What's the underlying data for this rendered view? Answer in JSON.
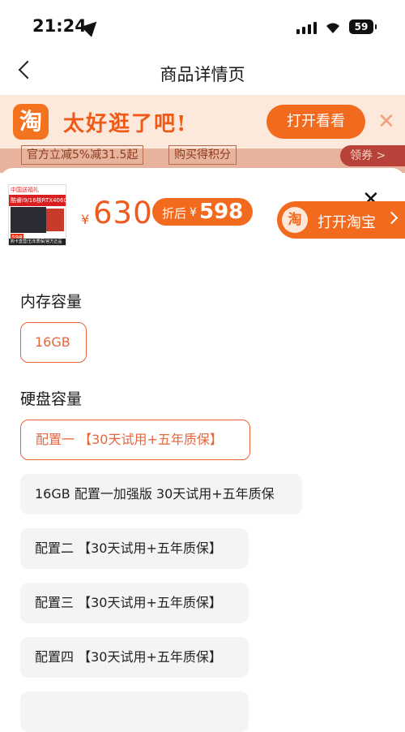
{
  "status_bar": {
    "time": "21:24",
    "battery": "59"
  },
  "nav": {
    "title": "商品详情页"
  },
  "banner": {
    "logo": "淘",
    "slogan": "太好逛了吧!",
    "open_label": "打开看看",
    "close": "✕"
  },
  "background_strip": {
    "tag1": "官方立减5%减31.5起",
    "tag2": "购买得积分",
    "coupon": "领券 >"
  },
  "product": {
    "thumb_line1": "中国送福礼",
    "thumb_line2": "酷睿i9/16核RTX4060独显",
    "thumb_price": "598",
    "thumb_footer": "购卡直营/五年质保/官方正品",
    "currency": "¥",
    "price": "630",
    "after_label": "折后",
    "after_price": "598"
  },
  "taobao_button": {
    "icon": "淘",
    "label": "打开淘宝"
  },
  "colors": {
    "accent": "#f26a1e",
    "selected_border": "#e8643a",
    "option_bg": "#f4f4f4"
  },
  "sections": {
    "memory": {
      "title": "内存容量",
      "options": [
        "16GB"
      ],
      "selected": "16GB"
    },
    "disk": {
      "title": "硬盘容量",
      "options": [
        "配置一 【30天试用+五年质保】",
        "16GB 配置一加强版 30天试用+五年质保",
        "配置二 【30天试用+五年质保】",
        "配置三 【30天试用+五年质保】",
        "配置四 【30天试用+五年质保】"
      ],
      "selected": "配置一 【30天试用+五年质保】"
    }
  }
}
